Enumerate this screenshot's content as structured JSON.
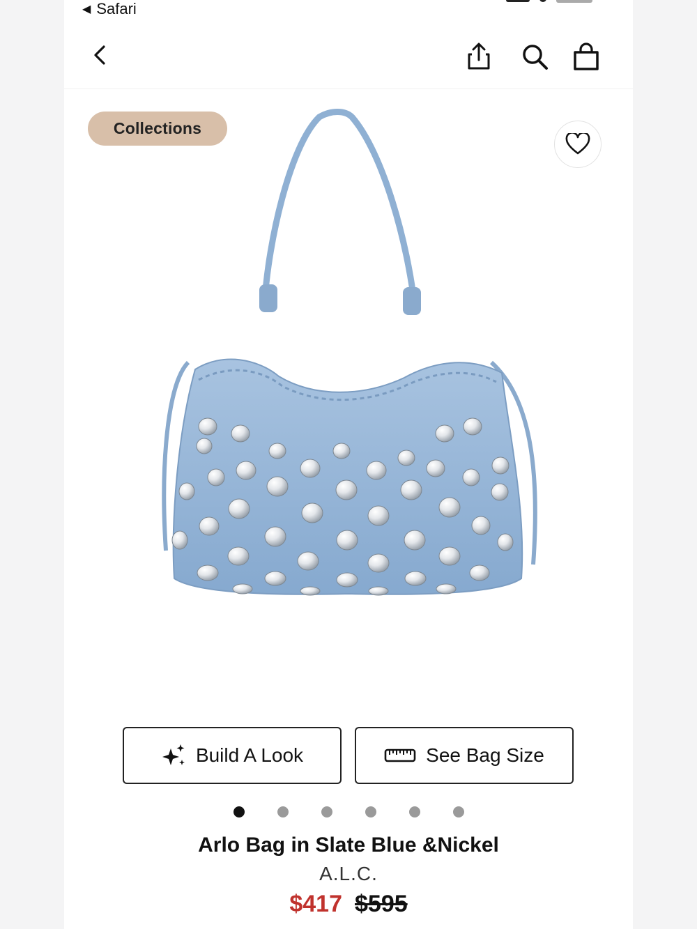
{
  "status": {
    "back_label": "Safari"
  },
  "badge": {
    "label": "Collections"
  },
  "actions": {
    "build_look": "Build A Look",
    "bag_size": "See Bag Size"
  },
  "gallery": {
    "count": 6,
    "active_index": 0
  },
  "product": {
    "title": "Arlo Bag in Slate Blue &Nickel",
    "brand": "A.L.C.",
    "sale_price": "$417",
    "original_price": "$595"
  },
  "colors": {
    "sale": "#c0322d",
    "badge": "#d8bfa9",
    "bag": "#8fb0d3"
  },
  "icons": [
    "back-chevron-icon",
    "share-icon",
    "search-icon",
    "shopping-bag-icon",
    "heart-icon",
    "sparkle-icon",
    "ruler-icon"
  ]
}
